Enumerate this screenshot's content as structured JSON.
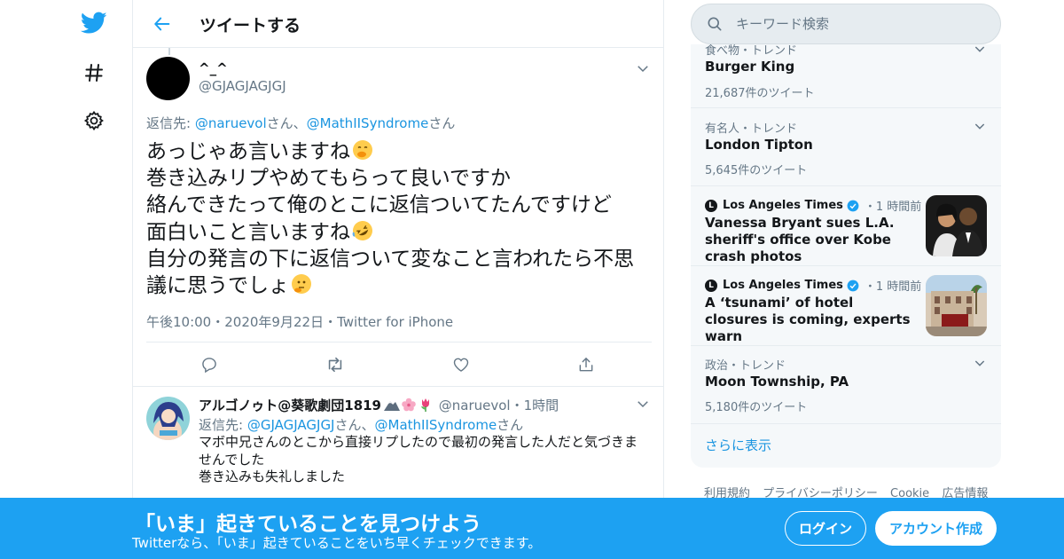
{
  "nav": {
    "icons": [
      "twitter-logo-icon",
      "hashtag-icon",
      "gear-icon"
    ]
  },
  "header": {
    "title": "ツイートする"
  },
  "tweet": {
    "name": "^_^",
    "handle": "@GJAGJAGJGJ",
    "reply_to": {
      "prefix": "返信先: ",
      "user1": "@naruevol",
      "sep": "さん、",
      "user2": "@MathIISyndrome",
      "suffix": "さん"
    },
    "lines": [
      "あっじゃあ言いますね",
      "巻き込みリプやめてもらって良いですか",
      "絡んできたって俺のとこに返信ついてたんですけど",
      "面白いこと言いますね",
      "自分の発言の下に返信ついて変なこと言われたら不思",
      "議に思うでしょ"
    ],
    "emojis": {
      "line1": "face-with-hand-over-mouth-emoji",
      "line4": "rofl-emoji",
      "line6": "thinking-face-emoji"
    },
    "meta": {
      "time": "午後10:00",
      "dot": "・",
      "date": "2020年9月22日",
      "source": "Twitter for iPhone"
    },
    "actions": [
      "reply-icon",
      "retweet-icon",
      "like-icon",
      "share-icon"
    ]
  },
  "reply": {
    "name": "アルゴノゥト@葵歌劇団1819",
    "handle": "@naruevol",
    "dot": "・",
    "time": "1時間",
    "reply_to": {
      "prefix": "返信先: ",
      "user1": "@GJAGJAGJGJ",
      "sep": "さん、",
      "user2": "@MathIISyndrome",
      "suffix": "さん"
    },
    "lines": [
      "マボ中兄さんのとこから直接リプしたので最初の発言した人だと気づきま",
      "せんでした",
      "巻き込みも失礼しました"
    ]
  },
  "search": {
    "placeholder": "キーワード検索"
  },
  "trends": [
    {
      "category": "食べ物・トレンド",
      "name": "Burger King",
      "count": "21,687件のツイート"
    },
    {
      "category": "有名人・トレンド",
      "name": "London Tipton",
      "count": "5,645件のツイート"
    },
    {
      "category": "政治・トレンド",
      "name": "Moon Township, PA",
      "count": "5,180件のツイート"
    }
  ],
  "news": [
    {
      "source": "Los Angeles Times",
      "dot": "・",
      "time": "1 時間前",
      "title": "Vanessa Bryant sues L.A. sheriff's office over Kobe crash photos"
    },
    {
      "source": "Los Angeles Times",
      "dot": "・",
      "time": "1 時間前",
      "title": "A ‘tsunami’ of hotel closures is coming, experts warn"
    }
  ],
  "show_more": "さらに表示",
  "footer": [
    "利用規約",
    "プライバシーポリシー",
    "Cookie",
    "広告情報"
  ],
  "banner": {
    "title": "「いま」起きていることを見つけよう",
    "subtitle": "Twitterなら、「いま」起きていることをいち早くチェックできます。",
    "login": "ログイン",
    "signup": "アカウント作成"
  },
  "colors": {
    "accent": "#1da1f2",
    "link": "#1b95e0",
    "muted": "#657786",
    "border": "#e6ecf0"
  }
}
